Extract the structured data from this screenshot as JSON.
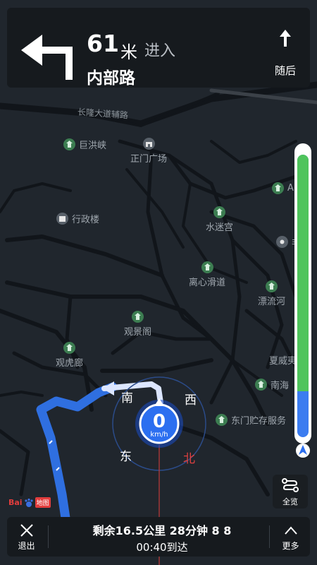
{
  "guidance": {
    "distance_value": "61",
    "distance_unit": "米",
    "action": "进入",
    "road_name": "内部路",
    "next_label": "随后",
    "turn_icon": "turn-left-icon",
    "next_icon": "arrow-up-icon"
  },
  "map": {
    "roads": [
      "长隆大道辅路"
    ],
    "pois": [
      {
        "name": "巨洪峡",
        "icon": "park-icon"
      },
      {
        "name": "正门广场",
        "icon": "gate-icon"
      },
      {
        "name": "行政楼",
        "icon": "building-icon"
      },
      {
        "name": "水迷宫",
        "icon": "park-icon"
      },
      {
        "name": "离心滑道",
        "icon": "park-icon"
      },
      {
        "name": "漂流河",
        "icon": "park-icon"
      },
      {
        "name": "观景阁",
        "icon": "park-icon"
      },
      {
        "name": "观虎廊",
        "icon": "park-icon"
      },
      {
        "name": "夏威夷",
        "icon": "park-icon"
      },
      {
        "name": "南海",
        "icon": "park-icon"
      },
      {
        "name": "东门贮存服务",
        "icon": "park-icon"
      },
      {
        "name": "A",
        "icon": "park-icon"
      },
      {
        "name": "非",
        "icon": "spot-icon"
      }
    ],
    "colors": {
      "route": "#2f6fe0",
      "map_bg": "#20262d",
      "road": "#11151a",
      "poi_pin": "#3c7d51"
    }
  },
  "compass": {
    "north": "北",
    "south": "南",
    "east": "东",
    "west": "西"
  },
  "speed": {
    "value": "0",
    "unit": "km/h"
  },
  "progress": {
    "completed_fraction": 0.93
  },
  "overview": {
    "label": "全览",
    "icon": "route-overview-icon"
  },
  "logo": {
    "text": "Bai",
    "map_text": "地图"
  },
  "bottom": {
    "exit_label": "退出",
    "remaining": "剩余16.5公里 28分钟 8 8",
    "arrive": "00:40到达",
    "more_label": "更多"
  }
}
